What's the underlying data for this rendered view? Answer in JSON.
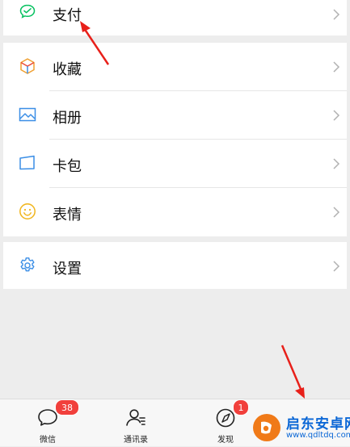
{
  "menu": {
    "pay": {
      "label": "支付",
      "icon": "wechat-pay-icon"
    },
    "items": [
      {
        "label": "收藏",
        "icon": "favorites-cube-icon"
      },
      {
        "label": "相册",
        "icon": "album-image-icon"
      },
      {
        "label": "卡包",
        "icon": "card-wallet-icon"
      },
      {
        "label": "表情",
        "icon": "smiley-face-icon"
      }
    ],
    "settings": {
      "label": "设置",
      "icon": "gear-icon"
    }
  },
  "tabbar": {
    "tabs": [
      {
        "label": "微信",
        "badge": "38",
        "icon": "chat-bubble-icon"
      },
      {
        "label": "通讯录",
        "icon": "contacts-icon"
      },
      {
        "label": "发现",
        "badge": "1",
        "icon": "compass-icon"
      }
    ]
  },
  "watermark": {
    "title": "启东安卓网",
    "url": "www.qdltdq.com"
  },
  "colors": {
    "accent_green": "#07c160",
    "badge_red": "#f1403c",
    "annotation_red": "#e8201a",
    "watermark_blue": "#0b67d6"
  }
}
